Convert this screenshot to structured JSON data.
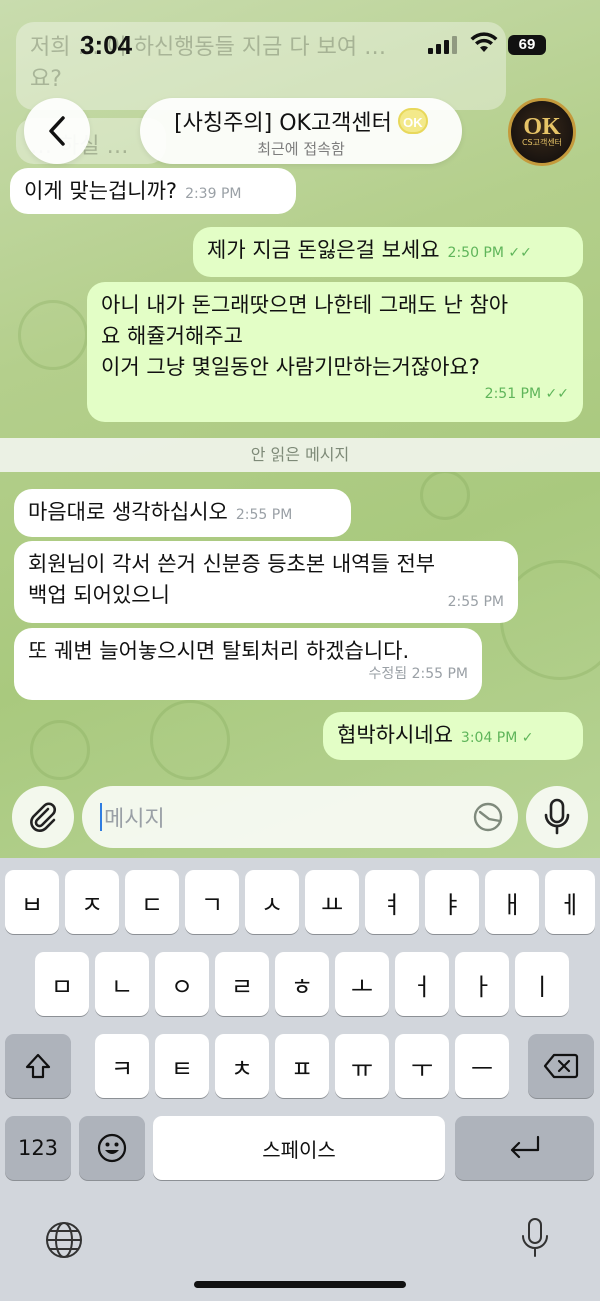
{
  "status_bar": {
    "time": "3:04",
    "battery": "69"
  },
  "header": {
    "title": "[사칭주의] OK고객센터",
    "title_emoji": "OK",
    "subtitle": "최근에 접속함",
    "avatar_text": "OK",
    "avatar_subtext": "CS고객센터"
  },
  "background_messages": [
    {
      "text": "저희 … 이 하신행동들 지금 다 보여 …"
    },
    {
      "text": "요?"
    },
    {
      "text": "… 하실 …"
    }
  ],
  "messages": [
    {
      "direction": "in",
      "text": "이게 맞는겁니까?",
      "time": "2:39 PM"
    },
    {
      "direction": "out",
      "text": "제가 지금 돈잃은걸 보세요",
      "time": "2:50 PM",
      "status": "read"
    },
    {
      "direction": "out",
      "lines": [
        "아니 내가 돈그래땃으면 나한테 그래도 난 참아",
        "요 해쥴거해주고",
        "이거 그냥 몇일동안 사람기만하는거잖아요?"
      ],
      "time": "2:51 PM",
      "status": "read"
    },
    {
      "direction": "in",
      "text": "마음대로 생각하십시오",
      "time": "2:55 PM"
    },
    {
      "direction": "in",
      "lines": [
        "회원님이 각서 쓴거 신분증 등초본 내역들 전부",
        "백업 되어있으니"
      ],
      "time": "2:55 PM"
    },
    {
      "direction": "in",
      "text": "또 궤변 늘어놓으시면 탈퇴처리 하겠습니다.",
      "edited": "수정됨",
      "time": "2:55 PM"
    },
    {
      "direction": "out",
      "text": "협박하시네요",
      "time": "3:04 PM",
      "status": "sent"
    }
  ],
  "unread_divider": "안 읽은 메시지",
  "composer": {
    "placeholder": "메시지"
  },
  "keyboard": {
    "row1": [
      "ㅂ",
      "ㅈ",
      "ㄷ",
      "ㄱ",
      "ㅅ",
      "ㅛ",
      "ㅕ",
      "ㅑ",
      "ㅐ",
      "ㅔ"
    ],
    "row2": [
      "ㅁ",
      "ㄴ",
      "ㅇ",
      "ㄹ",
      "ㅎ",
      "ㅗ",
      "ㅓ",
      "ㅏ",
      "ㅣ"
    ],
    "row3": [
      "ㅋ",
      "ㅌ",
      "ㅊ",
      "ㅍ",
      "ㅠ",
      "ㅜ",
      "ㅡ"
    ],
    "numbers_key": "123",
    "space_label": "스페이스"
  }
}
